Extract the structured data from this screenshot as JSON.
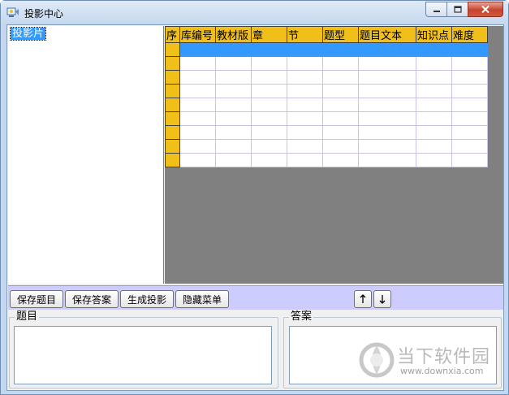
{
  "window": {
    "title": "投影中心",
    "icon": "projection-app-icon",
    "controls": {
      "minimize": "minimize-icon",
      "maximize": "maximize-icon",
      "close": "close-icon"
    }
  },
  "tree": {
    "root_label": "投影片"
  },
  "grid": {
    "columns": [
      "序",
      "库编号",
      "教材版",
      "章",
      "节",
      "题型",
      "题目文本",
      "知识点",
      "难度"
    ],
    "row_count": 9,
    "selected_row": 0
  },
  "toolbar": {
    "save_question": "保存题目",
    "save_answer": "保存答案",
    "generate": "生成投影",
    "hide_menu": "隐藏菜单",
    "up_icon": "arrow-up-icon",
    "down_icon": "arrow-down-icon"
  },
  "question_box": {
    "label": "题目"
  },
  "answer_box": {
    "label": "答案"
  },
  "watermark": {
    "text": "当下软件园",
    "url": "www.downxia.com"
  }
}
